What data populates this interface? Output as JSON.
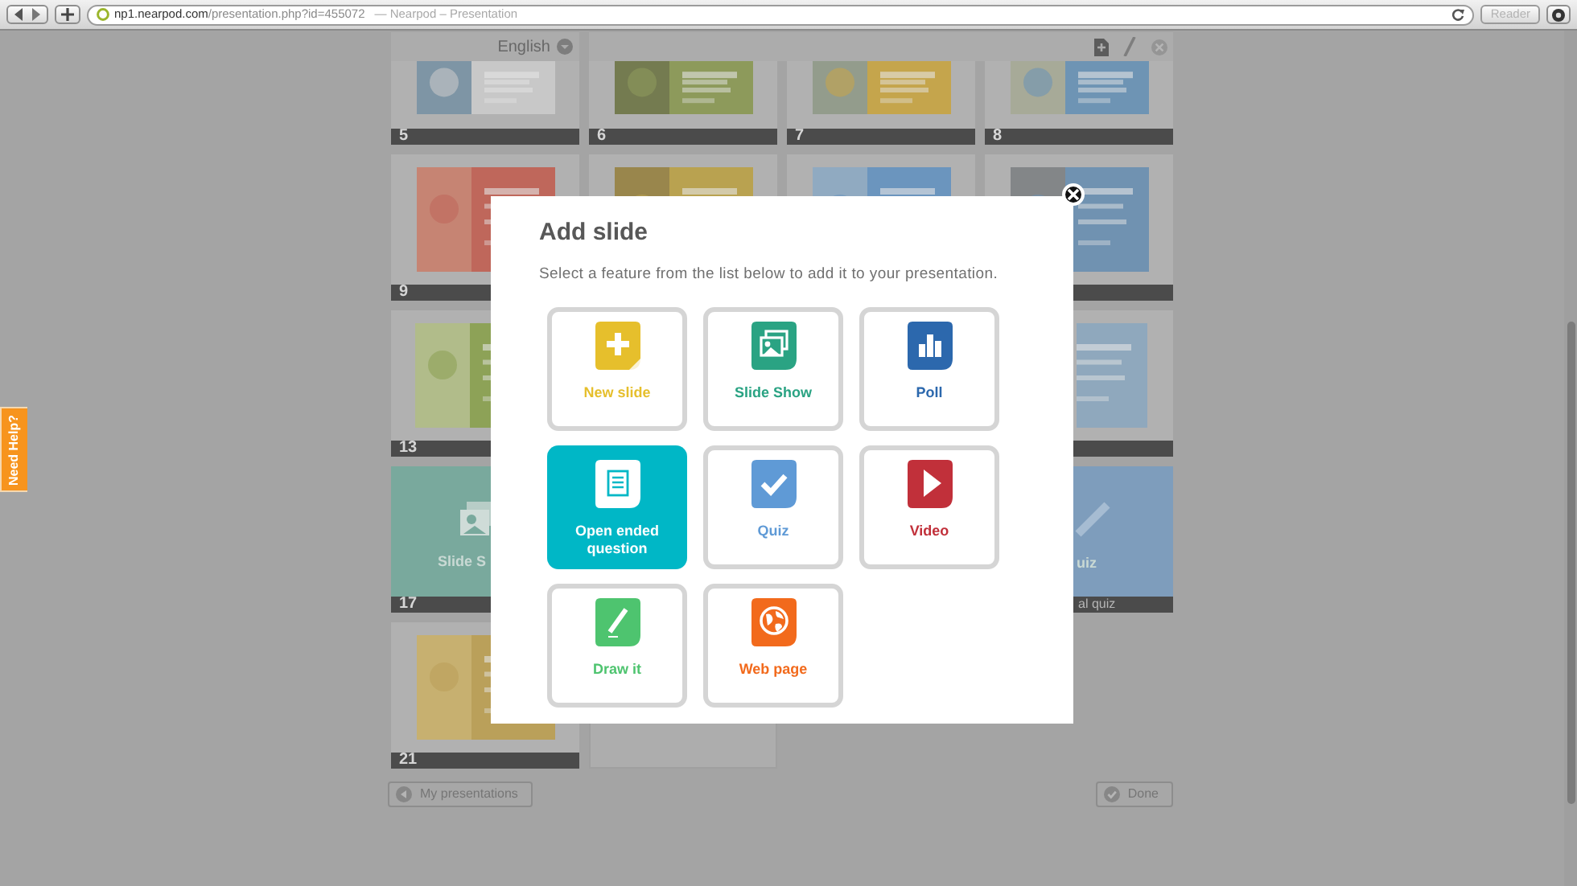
{
  "browser": {
    "url_host": "np1.nearpod.com",
    "url_path": "/presentation.php?id=455072",
    "page_title": "— Nearpod – Presentation",
    "reader_button": {
      "label": "Reader",
      "disabled": true
    }
  },
  "help_tab": "Need Help?",
  "toolbar": {
    "language": "English"
  },
  "slides": [
    {
      "kind": "picture",
      "number": "5"
    },
    {
      "kind": "picture",
      "number": "6"
    },
    {
      "kind": "picture",
      "number": "7"
    },
    {
      "kind": "picture",
      "number": "8"
    },
    {
      "kind": "picture",
      "number": "9"
    },
    {
      "kind": "peek"
    },
    {
      "kind": "peek"
    },
    {
      "kind": "picture"
    },
    {
      "kind": "picture",
      "number": "13"
    },
    {
      "kind": "covered"
    },
    {
      "kind": "covered"
    },
    {
      "kind": "picture"
    },
    {
      "kind": "slide-show",
      "number": "17",
      "label": "Slide S"
    },
    {
      "kind": "covered"
    },
    {
      "kind": "covered"
    },
    {
      "kind": "quiz",
      "label": "uiz",
      "caption": "al quiz"
    },
    {
      "kind": "picture",
      "number": "21"
    },
    {
      "kind": "blank"
    }
  ],
  "footer": {
    "back_button": "My presentations",
    "done_button": "Done"
  },
  "dialog": {
    "title": "Add slide",
    "subtitle": "Select a feature from the list below to add it to your presentation.",
    "features": [
      {
        "kind": "new-slide",
        "label": "New slide",
        "color": "#e6bf2c",
        "selected": false
      },
      {
        "kind": "slide-show",
        "label": "Slide Show",
        "color": "#2aa383",
        "selected": false
      },
      {
        "kind": "poll",
        "label": "Poll",
        "color": "#2c68ad",
        "selected": false
      },
      {
        "kind": "open-ended",
        "label": "Open ended question",
        "color": "#00b7c6",
        "selected": true
      },
      {
        "kind": "quiz",
        "label": "Quiz",
        "color": "#5f9ad6",
        "selected": false
      },
      {
        "kind": "video",
        "label": "Video",
        "color": "#c1303a",
        "selected": false
      },
      {
        "kind": "draw",
        "label": "Draw it",
        "color": "#4ec46f",
        "selected": false
      },
      {
        "kind": "web",
        "label": "Web page",
        "color": "#f26a1c",
        "selected": false
      }
    ]
  }
}
